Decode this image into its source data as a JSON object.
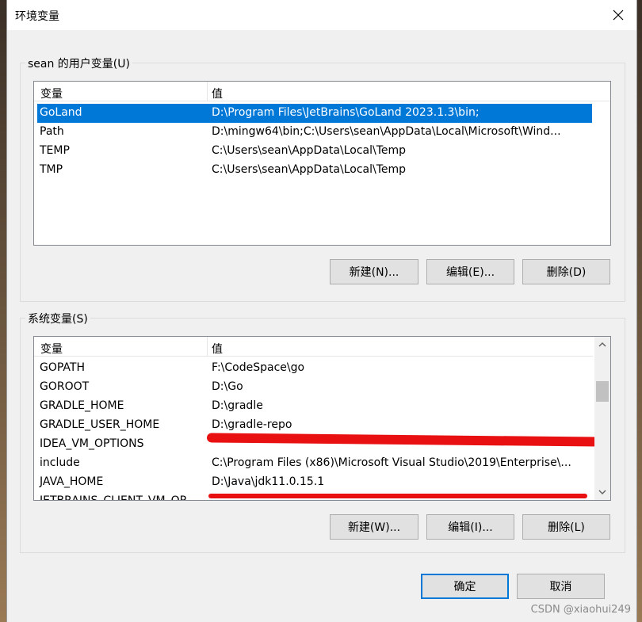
{
  "window": {
    "title": "环境变量",
    "close_icon": "close-icon"
  },
  "user_vars": {
    "group_label": "sean 的用户变量(U)",
    "columns": [
      "变量",
      "值"
    ],
    "rows": [
      {
        "name": "GoLand",
        "value": "D:\\Program Files\\JetBrains\\GoLand 2023.1.3\\bin;",
        "selected": true
      },
      {
        "name": "Path",
        "value": "D:\\mingw64\\bin;C:\\Users\\sean\\AppData\\Local\\Microsoft\\Wind..."
      },
      {
        "name": "TEMP",
        "value": "C:\\Users\\sean\\AppData\\Local\\Temp"
      },
      {
        "name": "TMP",
        "value": "C:\\Users\\sean\\AppData\\Local\\Temp"
      }
    ],
    "buttons": {
      "new": "新建(N)...",
      "edit": "编辑(E)...",
      "delete": "删除(D)"
    }
  },
  "system_vars": {
    "group_label": "系统变量(S)",
    "columns": [
      "变量",
      "值"
    ],
    "rows": [
      {
        "name": "GOPATH",
        "value": "F:\\CodeSpace\\go"
      },
      {
        "name": "GOROOT",
        "value": "D:\\Go"
      },
      {
        "name": "GRADLE_HOME",
        "value": "D:\\gradle"
      },
      {
        "name": "GRADLE_USER_HOME",
        "value": "D:\\gradle-repo"
      },
      {
        "name": "IDEA_VM_OPTIONS",
        "value": ""
      },
      {
        "name": "include",
        "value": "C:\\Program Files (x86)\\Microsoft Visual Studio\\2019\\Enterprise\\..."
      },
      {
        "name": "JAVA_HOME",
        "value": "D:\\Java\\jdk11.0.15.1"
      },
      {
        "name": "JETBRAINS_CLIENT_VM_OP",
        "value": ""
      }
    ],
    "buttons": {
      "new": "新建(W)...",
      "edit": "编辑(I)...",
      "delete": "删除(L)"
    }
  },
  "footer": {
    "ok": "确定",
    "cancel": "取消"
  },
  "watermark": "CSDN @xiaohui249",
  "colors": {
    "selection": "#0078d7",
    "redaction": "#e81010",
    "default_button_border": "#0078d7"
  }
}
